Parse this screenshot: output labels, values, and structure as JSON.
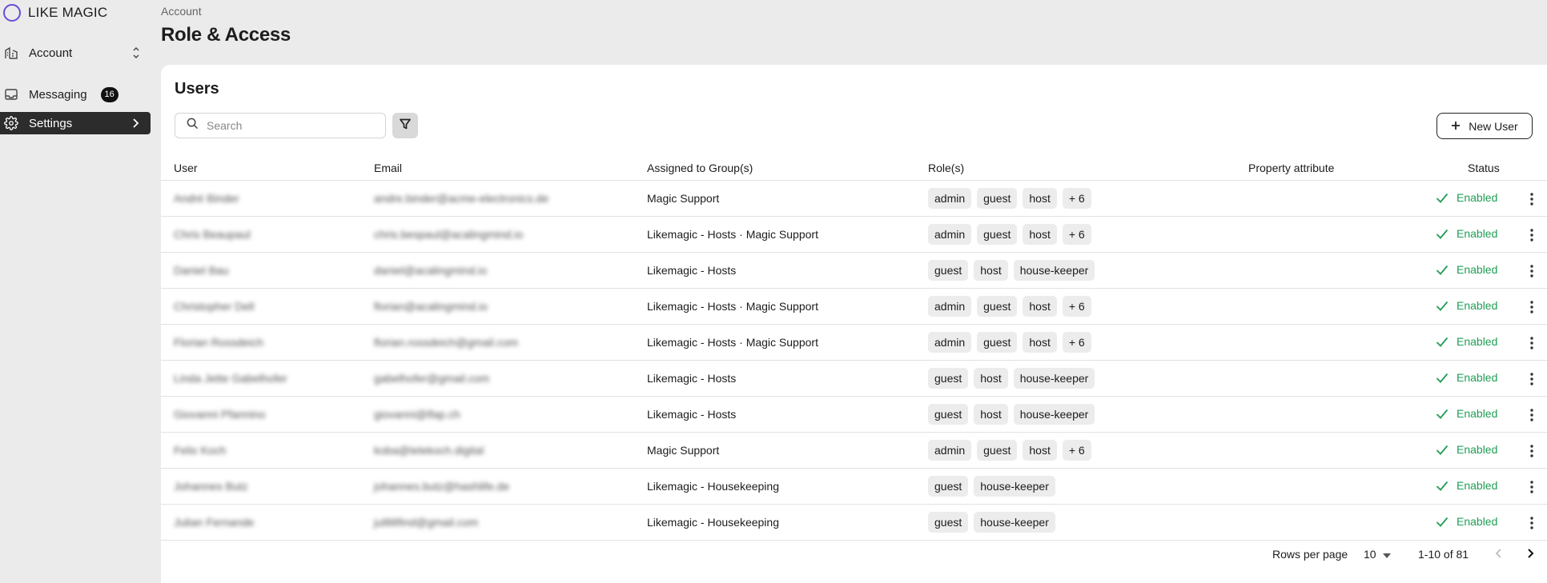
{
  "app": {
    "brand": "LIKE MAGIC",
    "accent": "#6a4bd8"
  },
  "sidebar": {
    "account_label": "Account",
    "messaging_label": "Messaging",
    "messaging_badge": "16",
    "settings_label": "Settings"
  },
  "header": {
    "breadcrumb": "Account",
    "title": "Role & Access"
  },
  "users": {
    "title": "Users",
    "search_placeholder": "Search",
    "new_user_label": "New User",
    "columns": {
      "user": "User",
      "email": "Email",
      "groups": "Assigned to Group(s)",
      "roles": "Role(s)",
      "property": "Property attribute",
      "status": "Status"
    },
    "rows": [
      {
        "user": "André Binder",
        "email": "andre.binder@acme-electronics.de",
        "groups": "Magic Support",
        "roles": [
          "admin",
          "guest",
          "host",
          "+ 6"
        ],
        "status": "Enabled"
      },
      {
        "user": "Chris Beaupaul",
        "email": "chris.bespaul@acalingmind.io",
        "groups": "Likemagic - Hosts · Magic Support",
        "roles": [
          "admin",
          "guest",
          "host",
          "+ 6"
        ],
        "status": "Enabled"
      },
      {
        "user": "Daniel Bau",
        "email": "daniel@acalingmind.io",
        "groups": "Likemagic - Hosts",
        "roles": [
          "guest",
          "host",
          "house-keeper"
        ],
        "status": "Enabled"
      },
      {
        "user": "Christopher Dell",
        "email": "florian@acalingmind.io",
        "groups": "Likemagic - Hosts · Magic Support",
        "roles": [
          "admin",
          "guest",
          "host",
          "+ 6"
        ],
        "status": "Enabled"
      },
      {
        "user": "Florian Rossdeich",
        "email": "florian.rossdeich@gmail.com",
        "groups": "Likemagic - Hosts · Magic Support",
        "roles": [
          "admin",
          "guest",
          "host",
          "+ 6"
        ],
        "status": "Enabled"
      },
      {
        "user": "Linda Jette Gabelhofer",
        "email": "gabelhofer@gmail.com",
        "groups": "Likemagic - Hosts",
        "roles": [
          "guest",
          "host",
          "house-keeper"
        ],
        "status": "Enabled"
      },
      {
        "user": "Giovanni Pfannino",
        "email": "giovanni@lfap.ch",
        "groups": "Likemagic - Hosts",
        "roles": [
          "guest",
          "host",
          "house-keeper"
        ],
        "status": "Enabled"
      },
      {
        "user": "Felix Koch",
        "email": "koba@telekoch.digital",
        "groups": "Magic Support",
        "roles": [
          "admin",
          "guest",
          "host",
          "+ 6"
        ],
        "status": "Enabled"
      },
      {
        "user": "Johannes Butz",
        "email": "johannes.butz@hashlife.de",
        "groups": "Likemagic - Housekeeping",
        "roles": [
          "guest",
          "house-keeper"
        ],
        "status": "Enabled"
      },
      {
        "user": "Julian Fernande",
        "email": "jul88find@gmail.com",
        "groups": "Likemagic - Housekeeping",
        "roles": [
          "guest",
          "house-keeper"
        ],
        "status": "Enabled"
      }
    ]
  },
  "pagination": {
    "rows_per_page_label": "Rows per page",
    "rows_per_page_value": "10",
    "range": "1-10 of 81"
  },
  "colors": {
    "enabled": "#1f9d55",
    "active_nav": "#2c2c2c"
  }
}
